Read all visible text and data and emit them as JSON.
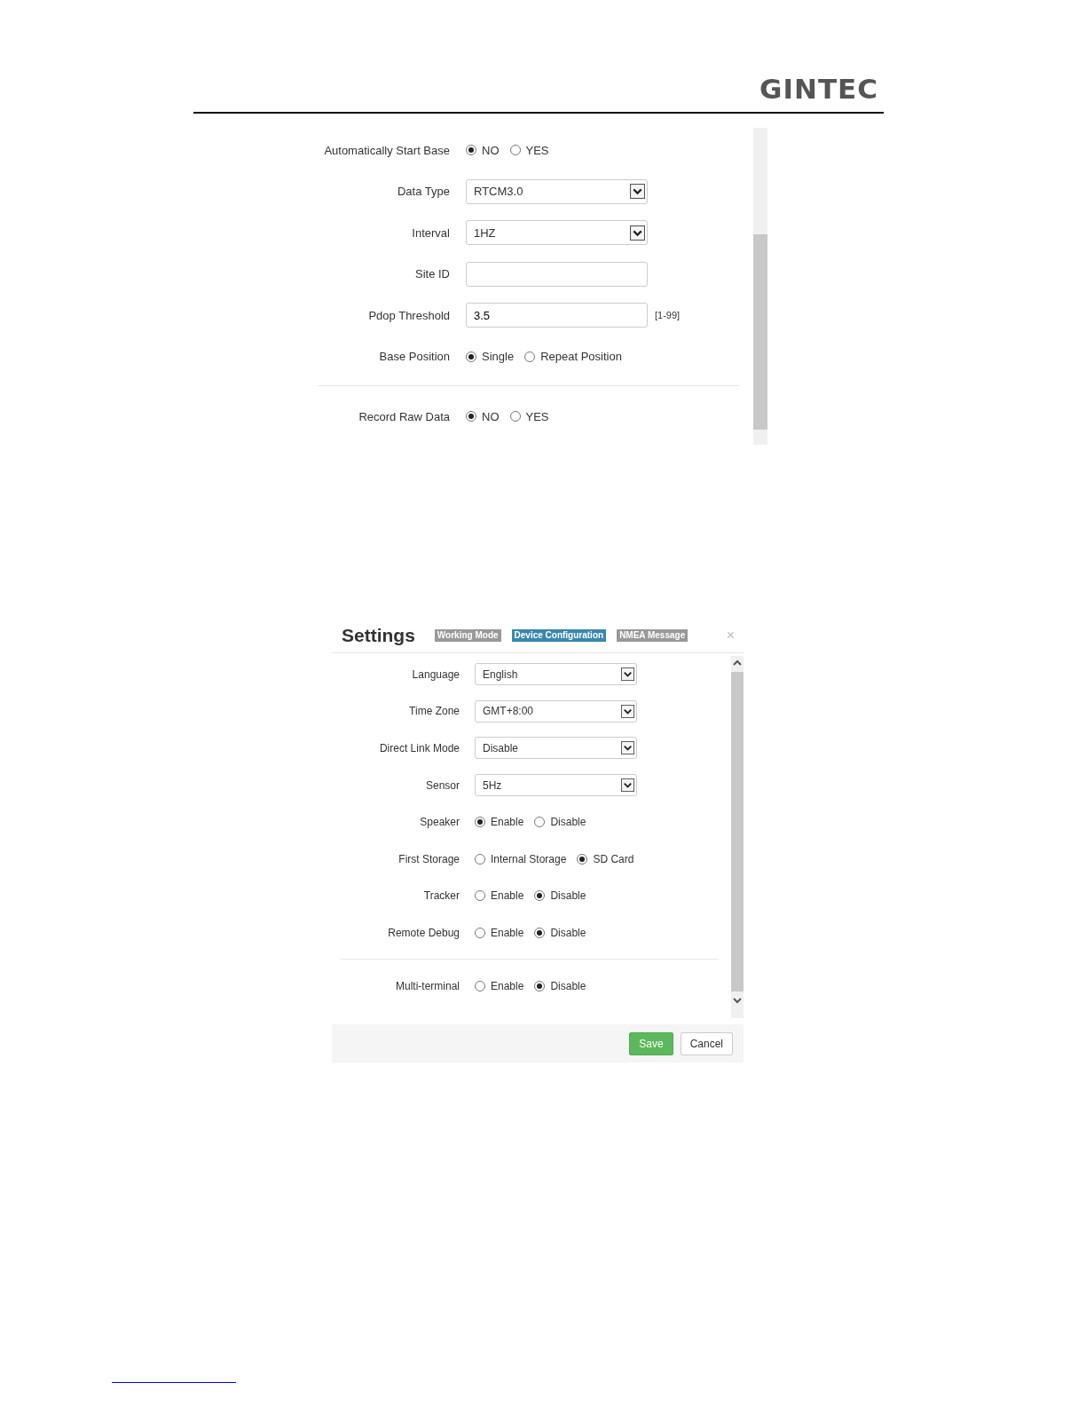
{
  "header": {
    "logo": "GINTEC"
  },
  "base_panel": {
    "sections": [
      {
        "rows": [
          {
            "kind": "radio",
            "label": "Automatically Start Base",
            "options": [
              {
                "label": "NO",
                "selected": true
              },
              {
                "label": "YES",
                "selected": false
              }
            ]
          },
          {
            "kind": "select",
            "label": "Data Type",
            "value": "RTCM3.0"
          },
          {
            "kind": "select",
            "label": "Interval",
            "value": "1HZ"
          },
          {
            "kind": "input",
            "label": "Site ID"
          },
          {
            "kind": "input",
            "label": "Pdop Threshold",
            "value": "3.5",
            "hint": "[1-99]"
          },
          {
            "kind": "radio",
            "label": "Base Position",
            "options": [
              {
                "label": "Single",
                "selected": true
              },
              {
                "label": "Repeat Position",
                "selected": false
              }
            ]
          }
        ]
      },
      {
        "rows": [
          {
            "kind": "radio",
            "label": "Record Raw Data",
            "options": [
              {
                "label": "NO",
                "selected": true
              },
              {
                "label": "YES",
                "selected": false
              }
            ]
          }
        ]
      }
    ]
  },
  "dialog": {
    "title": "Settings",
    "tabs": [
      {
        "label": "Working Mode",
        "selected": false
      },
      {
        "label": "Device Configuration",
        "selected": true
      },
      {
        "label": "NMEA Message",
        "selected": false
      }
    ],
    "close": "×",
    "sections": [
      {
        "rows": [
          {
            "kind": "select",
            "label": "Language",
            "value": "English"
          },
          {
            "kind": "select",
            "label": "Time Zone",
            "value": "GMT+8:00"
          },
          {
            "kind": "select",
            "label": "Direct Link Mode",
            "value": "Disable"
          },
          {
            "kind": "select",
            "label": "Sensor",
            "value": "5Hz"
          },
          {
            "kind": "radio",
            "label": "Speaker",
            "options": [
              {
                "label": "Enable",
                "selected": true
              },
              {
                "label": "Disable",
                "selected": false
              }
            ]
          },
          {
            "kind": "radio",
            "label": "First Storage",
            "options": [
              {
                "label": "Internal Storage",
                "selected": false
              },
              {
                "label": "SD Card",
                "selected": true
              }
            ]
          },
          {
            "kind": "radio",
            "label": "Tracker",
            "options": [
              {
                "label": "Enable",
                "selected": false
              },
              {
                "label": "Disable",
                "selected": true
              }
            ]
          },
          {
            "kind": "radio",
            "label": "Remote Debug",
            "options": [
              {
                "label": "Enable",
                "selected": false
              },
              {
                "label": "Disable",
                "selected": true
              }
            ]
          }
        ]
      },
      {
        "rows": [
          {
            "kind": "radio",
            "label": "Multi-terminal",
            "options": [
              {
                "label": "Enable",
                "selected": false
              },
              {
                "label": "Disable",
                "selected": true
              }
            ]
          }
        ]
      }
    ],
    "buttons": [
      {
        "label": "Save",
        "kind": "primary"
      },
      {
        "label": "Cancel",
        "kind": "default"
      }
    ]
  }
}
